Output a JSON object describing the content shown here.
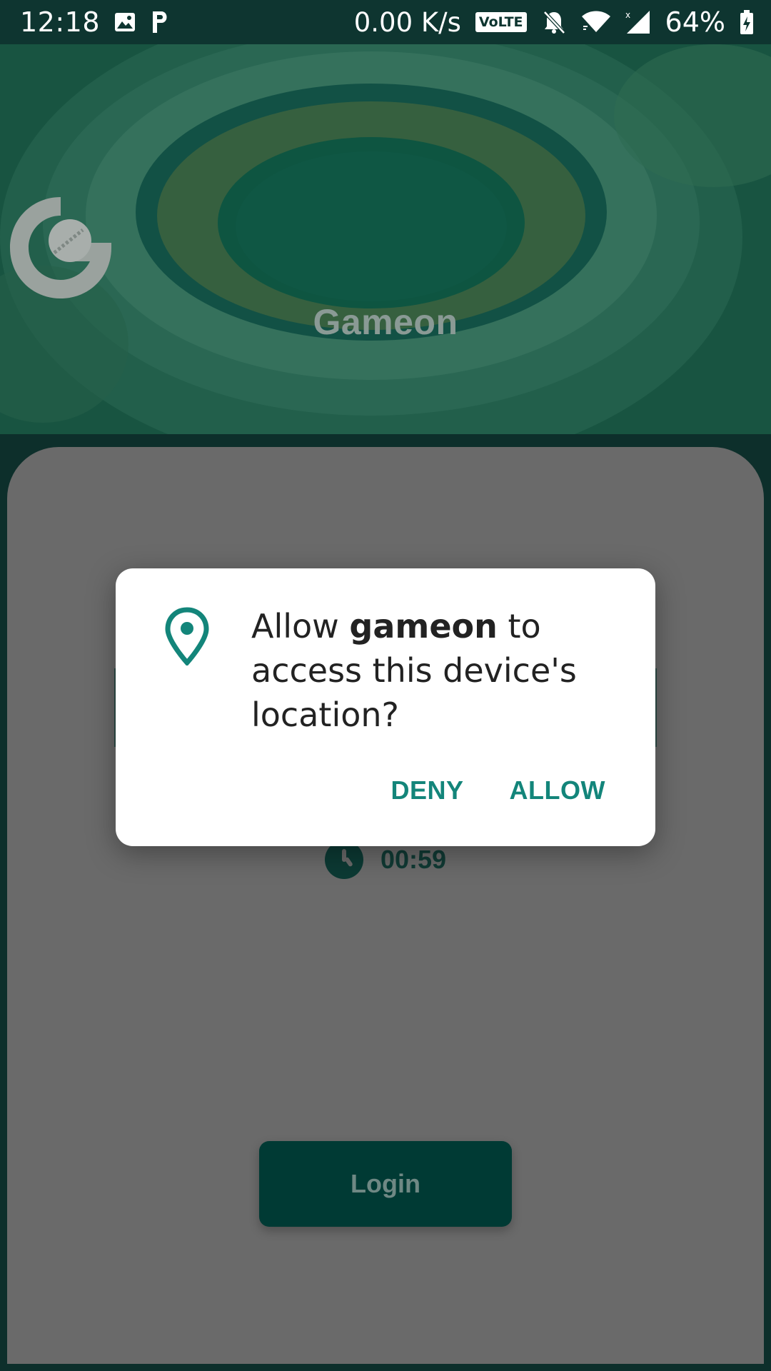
{
  "status_bar": {
    "time": "12:18",
    "net_speed": "0.00 K/s",
    "volte": "VoLTE",
    "battery": "64%",
    "icons": [
      "image-notification-icon",
      "parking-notification-icon",
      "volte-icon",
      "mute-icon",
      "wifi-icon",
      "signal-icon",
      "battery-charging-icon"
    ]
  },
  "app": {
    "brand_name": "Gameon",
    "timer": "00:59",
    "login_label": "Login",
    "colors": {
      "primary": "#003a34",
      "accent": "#13857a"
    }
  },
  "dialog": {
    "icon": "location-pin-icon",
    "message_prefix": "Allow ",
    "app_name": "gameon",
    "message_suffix": " to access this device's location?",
    "deny_label": "DENY",
    "allow_label": "ALLOW"
  }
}
